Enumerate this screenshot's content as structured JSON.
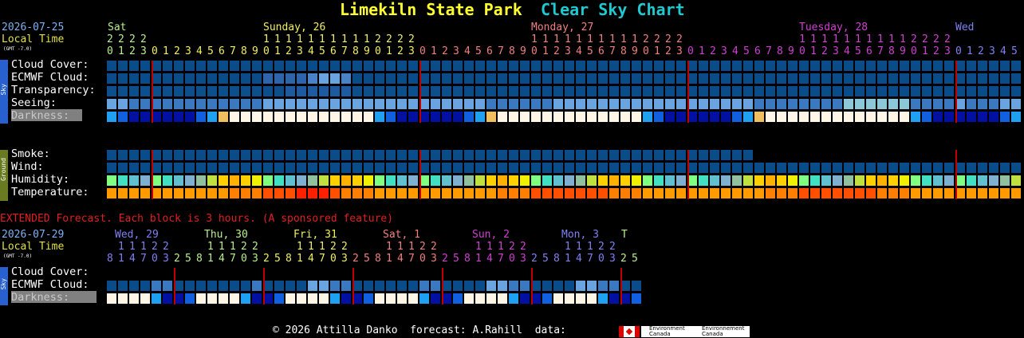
{
  "header": {
    "site": "Limekiln State Park",
    "chart": "Clear Sky Chart"
  },
  "top": {
    "date": "2026-07-25",
    "local_time": "Local Time",
    "gmt": "(GMT -7.0)",
    "days": [
      {
        "label": "Sat",
        "color": "#b8f08c"
      },
      {
        "label": "Sunday, 26",
        "color": "#f0f060"
      },
      {
        "label": "Monday, 27",
        "color": "#f08080"
      },
      {
        "label": "Tuesday, 28",
        "color": "#d040d0"
      },
      {
        "label": "Wed",
        "color": "#8080f0"
      }
    ],
    "tens_row": [
      "2",
      "2",
      "2",
      "2",
      "1",
      "1",
      "1",
      "1",
      "1",
      "1",
      "1",
      "1",
      "1",
      "1",
      "1",
      "1",
      "2",
      "2",
      "2",
      "2",
      "1",
      "1",
      "1",
      "1",
      "1",
      "1",
      "1",
      "1",
      "1",
      "1",
      "1",
      "1",
      "2",
      "2",
      "2",
      "2",
      "1",
      "1",
      "1",
      "1",
      "1",
      "1",
      "1",
      "1",
      "1",
      "1",
      "1",
      "1",
      "2",
      "2",
      "2",
      "2"
    ],
    "hours_row": "012301234567890123456789012301234567890123456789012301234567890123456789012301234567890123456789012301234 5",
    "row_labels": [
      "Cloud Cover:",
      "ECMWF Cloud:",
      "Transparency:",
      "Seeing:",
      "Darkness:"
    ],
    "ground_labels": [
      "Smoke:",
      "Wind:",
      "Humidity:",
      "Temperature:"
    ],
    "sky_tag": "Sky",
    "ground_tag": "Ground"
  },
  "extended": {
    "banner": "EXTENDED Forecast. Each block is 3 hours. (A sponsored feature)",
    "date": "2026-07-29",
    "local_time": "Local Time",
    "gmt": "(GMT -7.0)",
    "days": [
      {
        "label": "Wed, 29",
        "color": "#8080f0"
      },
      {
        "label": "Thu, 30",
        "color": "#b8f08c"
      },
      {
        "label": "Fri, 31",
        "color": "#f0f060"
      },
      {
        "label": "Sat, 1",
        "color": "#f08080"
      },
      {
        "label": "Sun, 2",
        "color": "#d040d0"
      },
      {
        "label": "Mon, 3",
        "color": "#8080f0"
      },
      {
        "label": "T",
        "color": "#b8f08c"
      }
    ],
    "tens_row": " 11122 ",
    "hours_row": "81470325",
    "row_labels": [
      "Cloud Cover:",
      "ECMWF Cloud:",
      "Darkness:"
    ],
    "sky_tag": "Sky"
  },
  "footer": {
    "copyright": "© 2026 Attilla Danko  forecast: A.Rahill  data:",
    "logo1": "Environment Canada",
    "logo2": "Environnement Canada"
  }
}
